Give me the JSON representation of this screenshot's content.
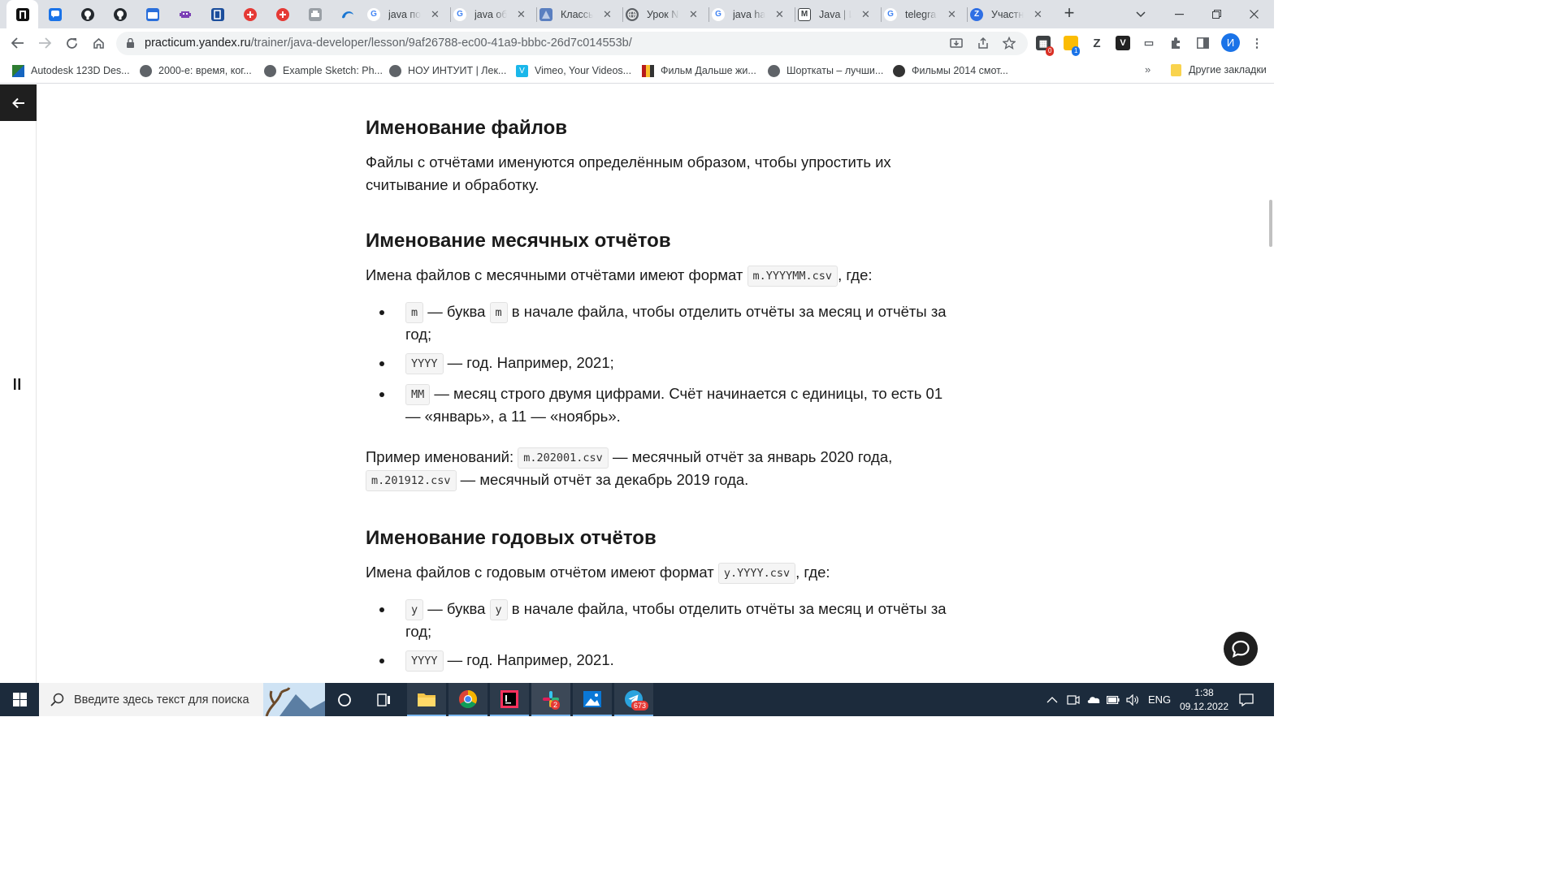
{
  "colors": {
    "accent": "#1a73e8",
    "page_dark": "#1f1f1f",
    "taskbar": "#1c2b3c"
  },
  "browser": {
    "tabs": [
      {
        "type": "pinned",
        "icon": "practicum-icon"
      },
      {
        "type": "pinned",
        "icon": "chat-icon"
      },
      {
        "type": "pinned",
        "icon": "github-icon"
      },
      {
        "type": "pinned",
        "icon": "github-icon"
      },
      {
        "type": "pinned",
        "icon": "tv-icon"
      },
      {
        "type": "pinned",
        "icon": "bug-icon"
      },
      {
        "type": "pinned",
        "icon": "book-icon"
      },
      {
        "type": "pinned",
        "icon": "plus-circle-icon"
      },
      {
        "type": "pinned",
        "icon": "plus-circle-icon"
      },
      {
        "type": "pinned",
        "icon": "printer-icon"
      },
      {
        "type": "pinned",
        "icon": "edge-icon"
      },
      {
        "title": "java по",
        "icon": "google-icon"
      },
      {
        "title": "java об",
        "icon": "google-icon"
      },
      {
        "title": "Классы",
        "icon": "files-icon"
      },
      {
        "title": "Урок N",
        "icon": "globe-icon"
      },
      {
        "title": "java ha",
        "icon": "google-icon"
      },
      {
        "title": "Java | И",
        "icon": "metanit-icon"
      },
      {
        "title": "telegra",
        "icon": "google-icon"
      },
      {
        "title": "Участн",
        "icon": "z-icon"
      }
    ],
    "url_host": "practicum.yandex.ru",
    "url_path": "/trainer/java-developer/lesson/9af26788-ec00-41a9-bbbc-26d7c014553b/",
    "profile_initial": "И",
    "extension_badges": [
      "0",
      "1"
    ],
    "bookmarks": [
      "Autodesk 123D Des...",
      "2000-е: время, ког...",
      "Example Sketch: Ph...",
      "НОУ ИНТУИТ | Лек...",
      "Vimeo, Your Videos...",
      "Фильм Дальше жи...",
      "Шорткаты – лучши...",
      "Фильмы 2014 смот..."
    ],
    "bookmarks_more": "»",
    "other_bookmarks": "Другие закладки"
  },
  "lesson": {
    "h_files": "Именование файлов",
    "p_files": "Файлы с отчётами именуются определённым образом, чтобы упростить их считывание и обработку.",
    "h_monthly": "Именование месячных отчётов",
    "monthly_intro_a": "Имена файлов с месячными отчётами имеют формат",
    "monthly_format": "m.YYYYMM.csv",
    "monthly_intro_b": ", где:",
    "monthly_items": [
      {
        "code": "m",
        "text_a": " — буква ",
        "code2": "m",
        "text_b": " в начале файла, чтобы отделить отчёты за месяц и отчёты за год;"
      },
      {
        "code": "YYYY",
        "text_a": " — год. Например, 2021;"
      },
      {
        "code": "MM",
        "text_a": " — месяц строго двумя цифрами. Счёт начинается с единицы, то есть 01 — «январь», а 11 — «ноябрь»."
      }
    ],
    "example_a": "Пример именований:",
    "example_code1": "m.202001.csv",
    "example_b": " — месячный отчёт за январь 2020 года,",
    "example_code2": "m.201912.csv",
    "example_c": " — месячный отчёт за декабрь 2019 года.",
    "h_yearly": "Именование годовых отчётов",
    "yearly_intro_a": "Имена файлов с годовым отчётом имеют формат",
    "yearly_format": "y.YYYY.csv",
    "yearly_intro_b": ", где:",
    "yearly_items": [
      {
        "code": "y",
        "text_a": " — буква ",
        "code2": "y",
        "text_b": " в начале файла, чтобы отделить отчёты за месяц и отчёты за год;"
      },
      {
        "code": "YYYY",
        "text_a": " — год. Например, 2021."
      }
    ]
  },
  "taskbar": {
    "search_placeholder": "Введите здесь текст для поиска",
    "apps": [
      "task-view",
      "file-explorer",
      "chrome",
      "intellij-idea",
      "slack",
      "photos",
      "telegram"
    ],
    "slack_badge": "2",
    "telegram_badge": "673",
    "language": "ENG",
    "time": "1:38",
    "date": "09.12.2022"
  }
}
